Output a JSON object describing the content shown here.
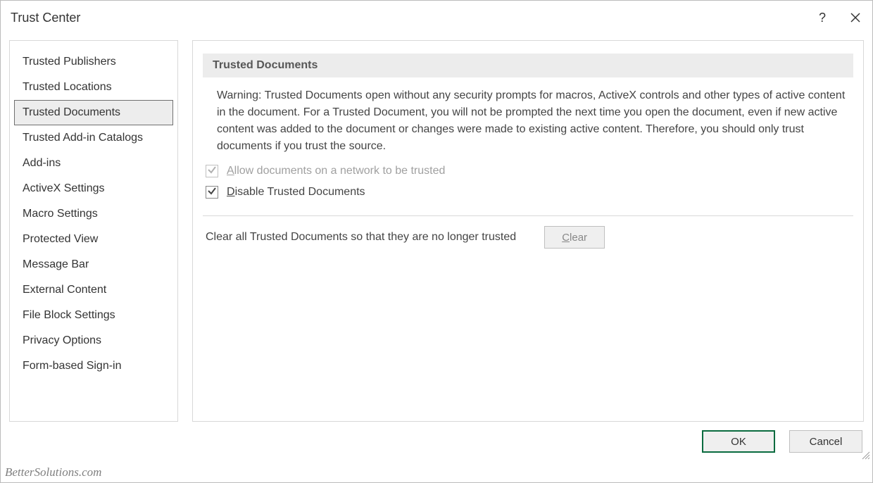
{
  "titlebar": {
    "title": "Trust Center"
  },
  "sidebar": {
    "items": [
      {
        "label": "Trusted Publishers",
        "name": "sidebar-item-trusted-publishers"
      },
      {
        "label": "Trusted Locations",
        "name": "sidebar-item-trusted-locations"
      },
      {
        "label": "Trusted Documents",
        "name": "sidebar-item-trusted-documents",
        "selected": true
      },
      {
        "label": "Trusted Add-in Catalogs",
        "name": "sidebar-item-trusted-addin-catalogs"
      },
      {
        "label": "Add-ins",
        "name": "sidebar-item-add-ins"
      },
      {
        "label": "ActiveX Settings",
        "name": "sidebar-item-activex-settings"
      },
      {
        "label": "Macro Settings",
        "name": "sidebar-item-macro-settings"
      },
      {
        "label": "Protected View",
        "name": "sidebar-item-protected-view"
      },
      {
        "label": "Message Bar",
        "name": "sidebar-item-message-bar"
      },
      {
        "label": "External Content",
        "name": "sidebar-item-external-content"
      },
      {
        "label": "File Block Settings",
        "name": "sidebar-item-file-block-settings"
      },
      {
        "label": "Privacy Options",
        "name": "sidebar-item-privacy-options"
      },
      {
        "label": "Form-based Sign-in",
        "name": "sidebar-item-form-based-signin"
      }
    ]
  },
  "main": {
    "section_title": "Trusted Documents",
    "warning_text": "Warning: Trusted Documents open without any security prompts for macros, ActiveX controls and other types of active content in the document.  For a Trusted Document, you will not be prompted the next time you open the document, even if new active content was added to the document or changes were made to existing active content. Therefore, you should only trust documents if you trust the source.",
    "allow_network": {
      "label_rest": "llow documents on a network to be trusted",
      "label_first": "A",
      "checked": true,
      "disabled": true
    },
    "disable_trusted": {
      "label_rest": "isable Trusted Documents",
      "label_first": "D",
      "checked": true,
      "disabled": false
    },
    "clear": {
      "label": "Clear all Trusted Documents so that they are no longer trusted",
      "button_first": "C",
      "button_rest": "lear",
      "disabled": true
    }
  },
  "footer": {
    "ok": "OK",
    "cancel": "Cancel"
  },
  "watermark": "BetterSolutions.com"
}
